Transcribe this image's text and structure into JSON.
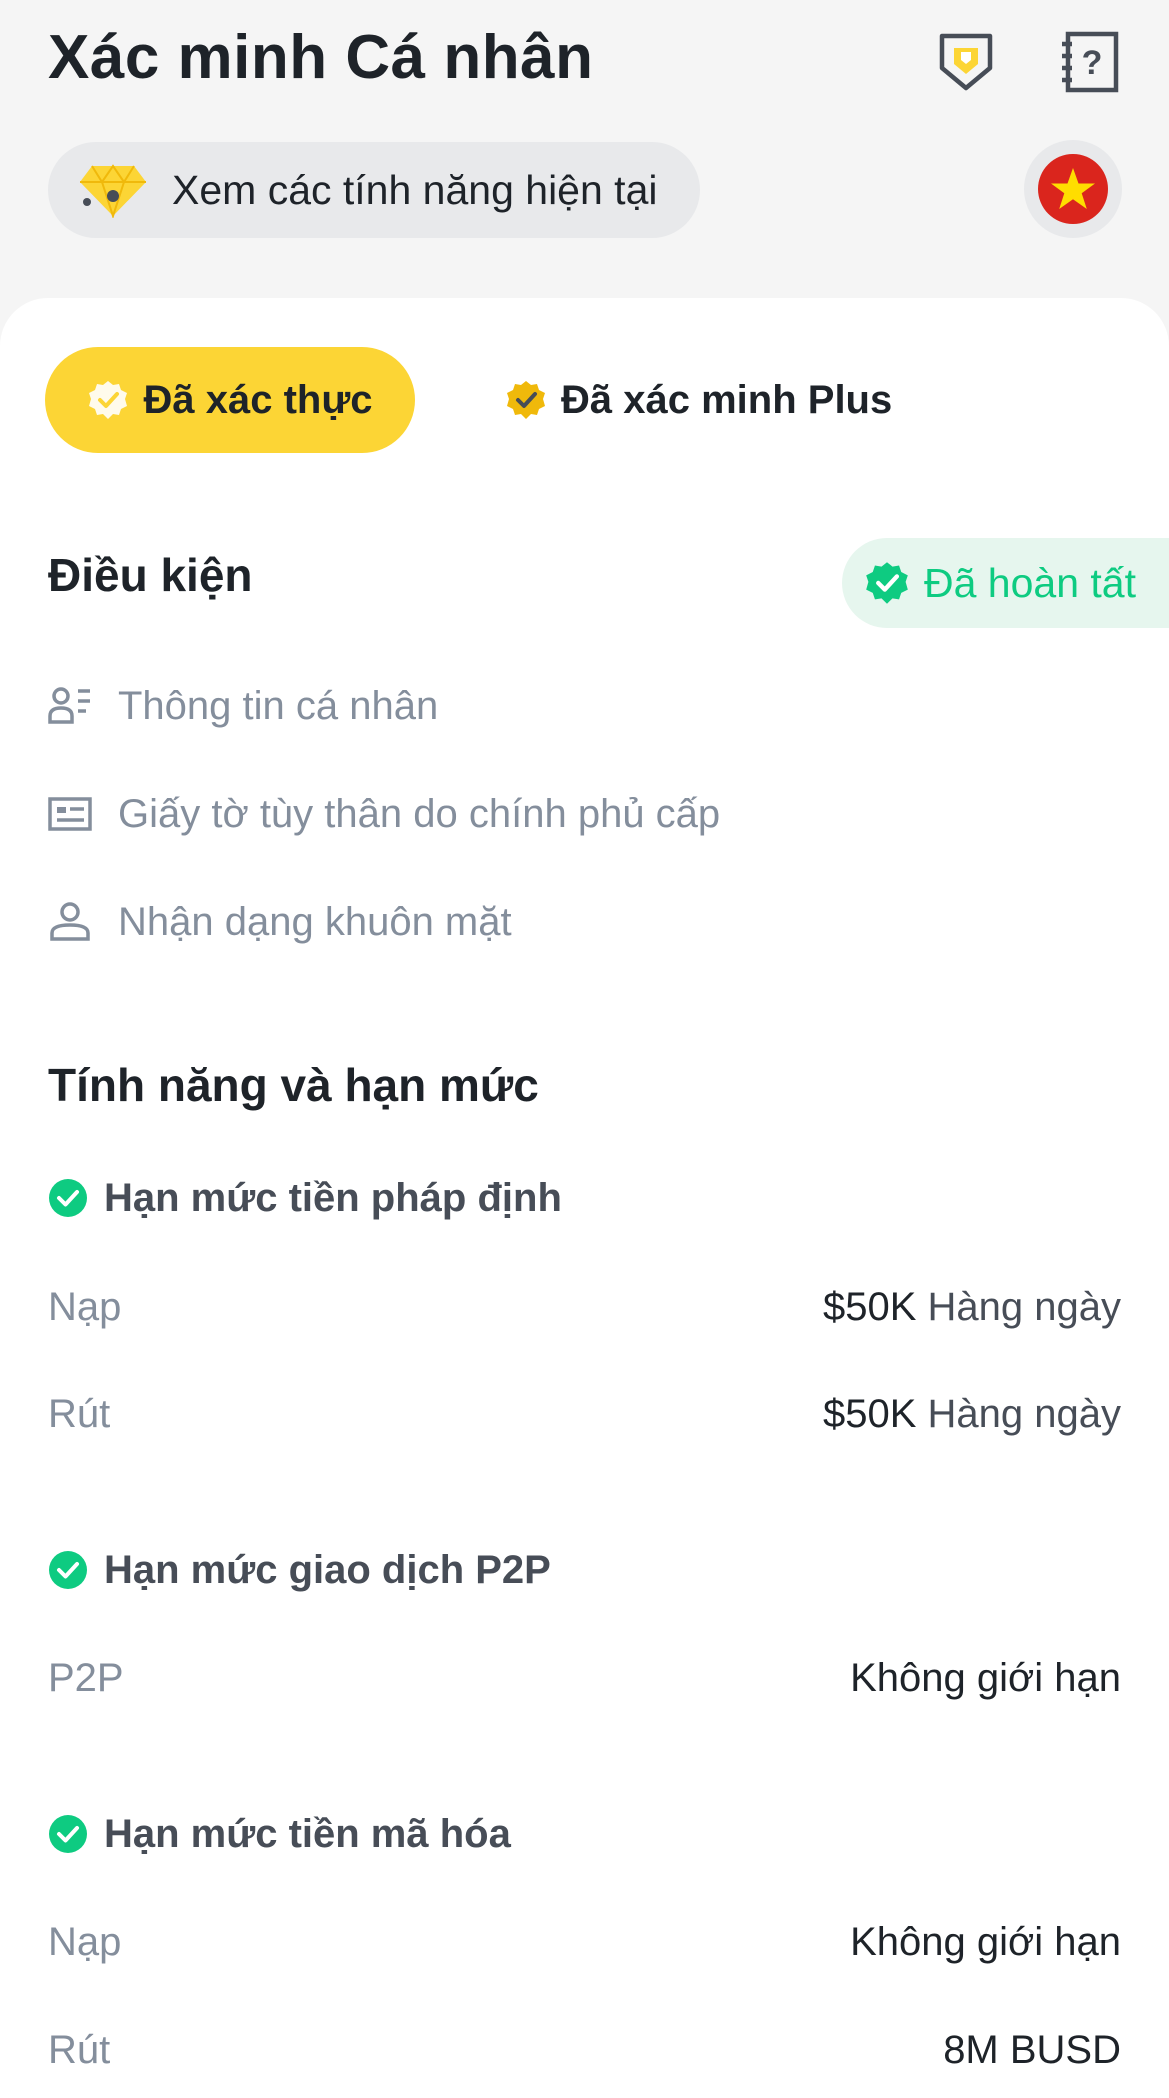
{
  "header": {
    "title": "Xác minh Cá nhân",
    "features_link": "Xem các tính năng hiện tại",
    "icons": [
      "shield-icon",
      "help-doc-icon",
      "vietnam-flag-icon",
      "diamond-icon"
    ]
  },
  "tabs": [
    {
      "label": "Đã xác thực",
      "active": true
    },
    {
      "label": "Đã xác minh Plus",
      "active": false
    }
  ],
  "requirements": {
    "title": "Điều kiện",
    "status": "Đã hoàn tất",
    "items": [
      {
        "label": "Thông tin cá nhân",
        "icon": "personal-info-icon"
      },
      {
        "label": "Giấy tờ tùy thân do chính phủ cấp",
        "icon": "id-card-icon"
      },
      {
        "label": "Nhận dạng khuôn mặt",
        "icon": "face-user-icon"
      }
    ]
  },
  "features": {
    "title": "Tính năng và hạn mức",
    "groups": [
      {
        "title": "Hạn mức tiền pháp định",
        "rows": [
          {
            "label": "Nạp",
            "value": "$50K",
            "unit": "Hàng ngày"
          },
          {
            "label": "Rút",
            "value": "$50K",
            "unit": "Hàng ngày"
          }
        ]
      },
      {
        "title": "Hạn mức giao dịch P2P",
        "rows": [
          {
            "label": "P2P",
            "value": "Không giới hạn"
          }
        ]
      },
      {
        "title": "Hạn mức tiền mã hóa",
        "rows": [
          {
            "label": "Nạp",
            "value": "Không giới hạn"
          },
          {
            "label": "Rút",
            "value": "8M BUSD"
          }
        ]
      }
    ]
  },
  "colors": {
    "accent": "#fcd535",
    "success": "#0ecb81",
    "text_primary": "#1e2329",
    "text_secondary": "#848e9c"
  }
}
